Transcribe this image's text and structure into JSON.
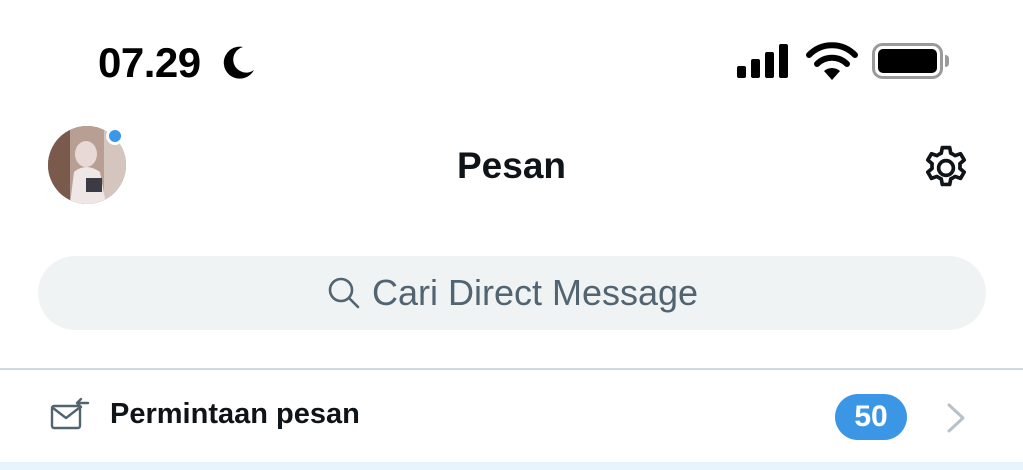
{
  "status_bar": {
    "time": "07.29",
    "icons": [
      "moon-icon",
      "signal-icon",
      "wifi-icon",
      "battery-icon"
    ]
  },
  "header": {
    "title": "Pesan",
    "avatar": "profile-avatar",
    "settings_icon": "gear-icon"
  },
  "search": {
    "placeholder": "Cari Direct Message",
    "icon": "search-icon"
  },
  "requests": {
    "label": "Permintaan pesan",
    "count": "50",
    "icon": "mail-request-icon",
    "chevron": "chevron-right-icon"
  },
  "colors": {
    "accent": "#3b96e6",
    "text_primary": "#0f1419",
    "text_secondary": "#536471",
    "search_bg": "#eff3f4",
    "divider": "#cfd9de"
  }
}
